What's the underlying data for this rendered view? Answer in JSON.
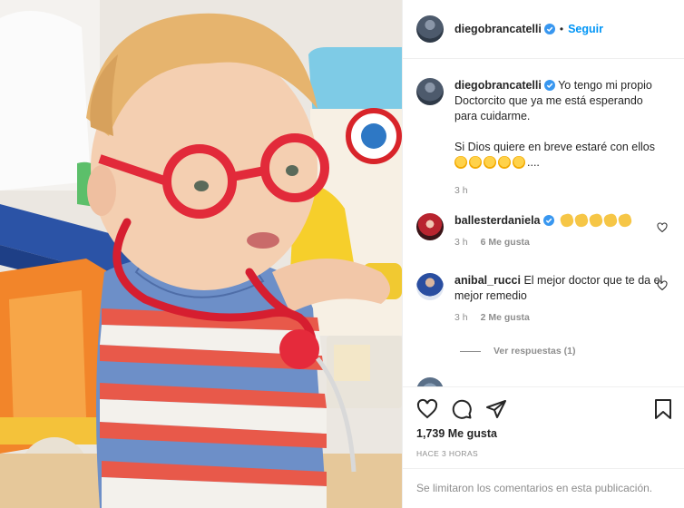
{
  "post": {
    "author": {
      "username": "diegobrancatelli",
      "verified": true
    },
    "follow_label": "Seguir",
    "caption": {
      "username": "diegobrancatelli",
      "text_lines": [
        "Yo tengo mi propio Doctorcito que ya me está esperando para cuidarme.",
        "Si Dios quiere en breve estaré con ellos"
      ],
      "emoji": "star-struck-emoji x5",
      "suffix": "....",
      "time": "3 h"
    },
    "comments": [
      {
        "username": "ballesterdaniela",
        "verified": true,
        "emoji": "clapping-hands-emoji x5",
        "time": "3 h",
        "likes": "6 Me gusta"
      },
      {
        "username": "anibal_rucci",
        "text": "El mejor doctor que te da el mejor remedio",
        "time": "3 h",
        "likes": "2 Me gusta"
      }
    ],
    "view_replies": "Ver respuestas (1)",
    "likes_count": "1,739 Me gusta",
    "timestamp": "HACE 3 HORAS",
    "comments_limited": "Se limitaron los comentarios en esta publicación."
  },
  "colors": {
    "accent": "#0095f6",
    "text": "#262626",
    "muted": "#8e8e8e",
    "border": "#efefef"
  },
  "icons": [
    "heart-icon",
    "comment-icon",
    "share-icon",
    "bookmark-icon",
    "verified-icon"
  ]
}
